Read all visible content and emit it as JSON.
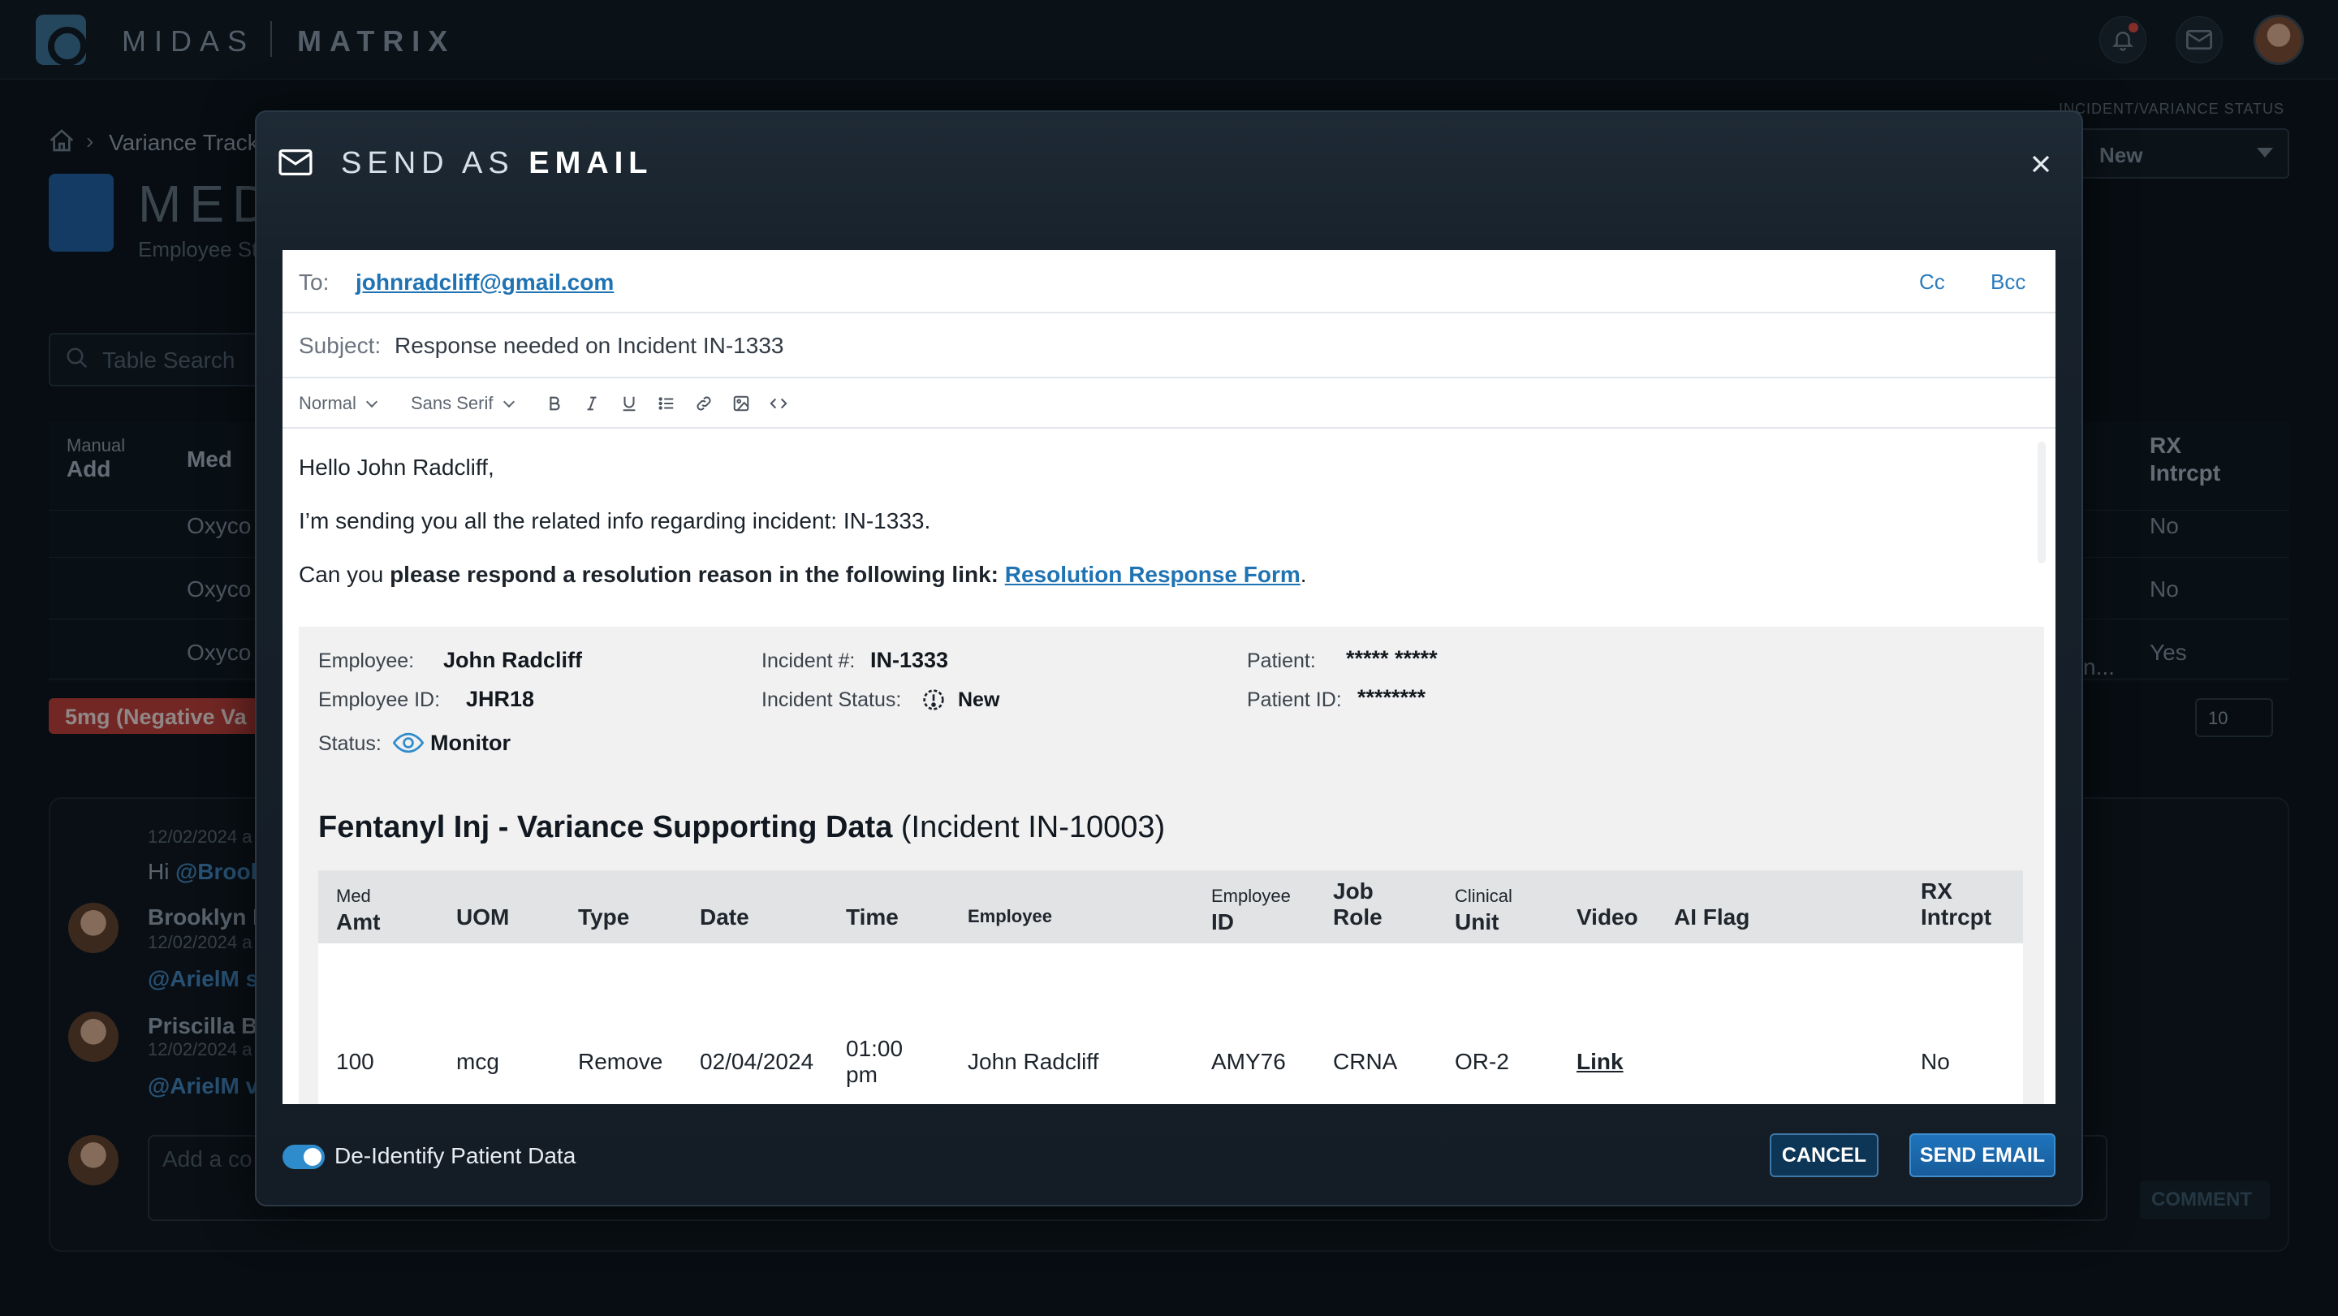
{
  "app": {
    "brand_left": "MIDAS",
    "brand_right": "MATRIX",
    "breadcrumb": "Variance Track",
    "page_title": "MED",
    "page_subtitle": "Employee St",
    "status_label": "INCIDENT/VARIANCE STATUS",
    "status_value": "New",
    "table_search_placeholder": "Table Search",
    "table_headers": {
      "manual_top": "Manual",
      "manual_bottom": "Add",
      "med": "Med",
      "rx_top": "RX",
      "rx_bottom": "Intrcpt"
    },
    "rows": [
      {
        "med": "Oxyco",
        "rx": "No"
      },
      {
        "med": "Oxyco",
        "rx": "No"
      },
      {
        "med": "Oxyco",
        "rx": "Yes",
        "extra": "n..."
      }
    ],
    "negative_badge": "5mg (Negative Va",
    "page_size": "10",
    "comments": {
      "first_date": "12/02/2024 a",
      "first_text_prefix": "Hi",
      "first_mention": "@Brook",
      "items": [
        {
          "name": "Brooklyn E",
          "date": "12/02/2024 a",
          "mention": "@ArielM s"
        },
        {
          "name": "Priscilla Ba",
          "date": "12/02/2024 a",
          "mention": "@ArielM v"
        }
      ],
      "input_placeholder": "Add a co",
      "submit_label": "COMMENT"
    }
  },
  "modal": {
    "title_light": "SEND AS",
    "title_bold": "EMAIL",
    "to_label": "To:",
    "to_value": "johnradcliff@gmail.com",
    "cc_label": "Cc",
    "bcc_label": "Bcc",
    "subject_label": "Subject:",
    "subject_value": "Response needed on Incident IN-1333",
    "toolbar": {
      "format_select": "Normal",
      "font_select": "Sans Serif"
    },
    "body": {
      "greeting": "Hello John Radcliff,",
      "line2": "I’m sending you all the related info regarding incident: IN-1333.",
      "line3_prefix": "Can you",
      "line3_bold": "please respond a resolution reason in the following link:",
      "line3_link": "Resolution Response Form",
      "line3_suffix": "."
    },
    "info": {
      "employee_label": "Employee:",
      "employee_value": "John Radcliff",
      "employee_id_label": "Employee ID:",
      "employee_id_value": "JHR18",
      "status_label": "Status:",
      "status_value": "Monitor",
      "incident_label": "Incident #:",
      "incident_value": "IN-1333",
      "incident_status_label": "Incident Status:",
      "incident_status_value": "New",
      "patient_label": "Patient:",
      "patient_value": "***** *****",
      "patient_id_label": "Patient ID:",
      "patient_id_value": "********"
    },
    "supporting_data": {
      "title_bold": "Fentanyl Inj - Variance Supporting Data",
      "title_rest": "(Incident IN-10003)",
      "columns": [
        {
          "top": "Med",
          "bottom": "Amt"
        },
        {
          "top": "",
          "bottom": "UOM"
        },
        {
          "top": "",
          "bottom": "Type"
        },
        {
          "top": "",
          "bottom": "Date"
        },
        {
          "top": "",
          "bottom": "Time"
        },
        {
          "top": "",
          "bottom": "Employee"
        },
        {
          "top": "Employee",
          "bottom": "ID"
        },
        {
          "top": "Job",
          "bottom": "Role"
        },
        {
          "top": "Clinical",
          "bottom": "Unit"
        },
        {
          "top": "",
          "bottom": "Video"
        },
        {
          "top": "",
          "bottom": "AI Flag"
        },
        {
          "top": "RX",
          "bottom": "Intrcpt"
        }
      ],
      "row": {
        "med_amt": "100",
        "uom": "mcg",
        "type": "Remove",
        "date": "02/04/2024",
        "time_line1": "01:00",
        "time_line2": "pm",
        "employee": "John Radcliff",
        "employee_id": "AMY76",
        "job_role": "CRNA",
        "clinical_unit": "OR-2",
        "video": "Link",
        "ai_flag": "",
        "rx_intrcpt": "No"
      }
    },
    "deidentify_label": "De-Identify Patient Data",
    "deidentify_on": true,
    "cancel_label": "CANCEL",
    "send_label": "SEND EMAIL"
  },
  "colors": {
    "accent": "#1f73b3",
    "background": "#0b1118",
    "modal": "#17212b",
    "danger": "#b63b34"
  }
}
